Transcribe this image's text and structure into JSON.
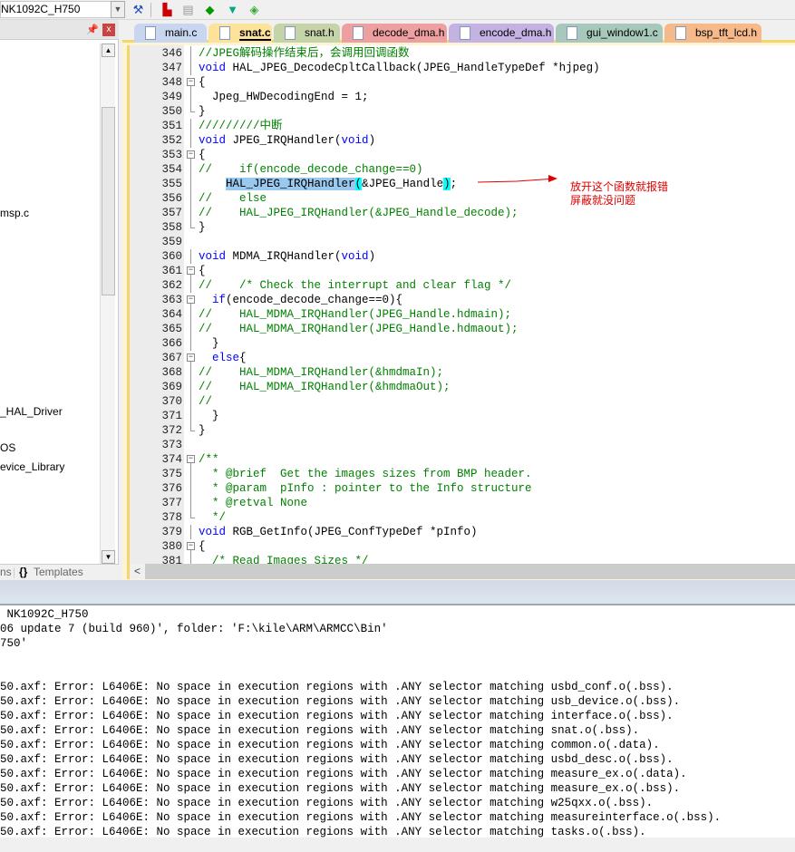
{
  "toolbar": {
    "target": "NK1092C_H750",
    "icons": [
      "magic-wand-icon",
      "build-icon",
      "batch-build-icon",
      "options-icon",
      "filter-icon",
      "pack-installer-icon"
    ]
  },
  "left_panel": {
    "tree_items": [
      "msp.c",
      "_HAL_Driver",
      "OS",
      "evice_Library"
    ],
    "bottom_tabs": [
      "ns",
      "Templates"
    ]
  },
  "tabs": [
    {
      "label": "main.c",
      "color": "#c9d6f0",
      "active": false
    },
    {
      "label": "snat.c",
      "color": "#fde39a",
      "active": true
    },
    {
      "label": "snat.h",
      "color": "#c4d3a8",
      "active": false
    },
    {
      "label": "decode_dma.h",
      "color": "#ee9f9f",
      "active": false
    },
    {
      "label": "encode_dma.h",
      "color": "#c4b2e2",
      "active": false
    },
    {
      "label": "gui_window1.c",
      "color": "#a7c8bb",
      "active": false
    },
    {
      "label": "bsp_tft_lcd.h",
      "color": "#f6b98a",
      "active": false
    }
  ],
  "code": [
    {
      "n": "346",
      "s": [
        [
          "//JPEG解码操作结束后，会调用回调函数",
          "cm"
        ]
      ]
    },
    {
      "n": "347",
      "s": [
        [
          "void",
          "kw"
        ],
        [
          " HAL_JPEG_DecodeCpltCallback(JPEG_HandleTypeDef *hjpeg)",
          "tx"
        ]
      ]
    },
    {
      "n": "348",
      "f": "open",
      "s": [
        [
          "{",
          "tx"
        ]
      ]
    },
    {
      "n": "349",
      "s": [
        [
          "  Jpeg_HWDecodingEnd = 1;",
          "tx"
        ]
      ]
    },
    {
      "n": "350",
      "f": "end",
      "s": [
        [
          "}",
          "tx"
        ]
      ]
    },
    {
      "n": "351",
      "s": [
        [
          "/////////中断",
          "cm"
        ]
      ]
    },
    {
      "n": "352",
      "s": [
        [
          "void",
          "kw"
        ],
        [
          " JPEG_IRQHandler(",
          "tx"
        ],
        [
          "void",
          "kw"
        ],
        [
          ")",
          "tx"
        ]
      ]
    },
    {
      "n": "353",
      "f": "open",
      "s": [
        [
          "{",
          "tx"
        ]
      ]
    },
    {
      "n": "354",
      "s": [
        [
          "//    if(encode_decode_change==0)",
          "cm"
        ]
      ]
    },
    {
      "n": "355",
      "s": [
        [
          "    ",
          "tx"
        ],
        [
          "HAL_JPEG_IRQHandler",
          "hl"
        ],
        [
          "(",
          "br"
        ],
        [
          "&JPEG_Handle",
          "tx"
        ],
        [
          ")",
          "br"
        ],
        [
          ";",
          "tx"
        ]
      ]
    },
    {
      "n": "356",
      "s": [
        [
          "//    else",
          "cm"
        ]
      ]
    },
    {
      "n": "357",
      "s": [
        [
          "//    HAL_JPEG_IRQHandler(&JPEG_Handle_decode);",
          "cm"
        ]
      ]
    },
    {
      "n": "358",
      "f": "end",
      "s": [
        [
          "}",
          "tx"
        ]
      ]
    },
    {
      "n": "359",
      "s": []
    },
    {
      "n": "360",
      "s": [
        [
          "void",
          "kw"
        ],
        [
          " MDMA_IRQHandler(",
          "tx"
        ],
        [
          "void",
          "kw"
        ],
        [
          ")",
          "tx"
        ]
      ]
    },
    {
      "n": "361",
      "f": "open",
      "s": [
        [
          "{",
          "tx"
        ]
      ]
    },
    {
      "n": "362",
      "s": [
        [
          "//    /* Check the interrupt and clear flag */",
          "cm"
        ]
      ]
    },
    {
      "n": "363",
      "f": "open",
      "s": [
        [
          "  ",
          "tx"
        ],
        [
          "if",
          "kw"
        ],
        [
          "(encode_decode_change==0){",
          "tx"
        ]
      ]
    },
    {
      "n": "364",
      "s": [
        [
          "//    HAL_MDMA_IRQHandler(JPEG_Handle.hdmain);",
          "cm"
        ]
      ]
    },
    {
      "n": "365",
      "s": [
        [
          "//    HAL_MDMA_IRQHandler(JPEG_Handle.hdmaout);",
          "cm"
        ]
      ]
    },
    {
      "n": "366",
      "s": [
        [
          "  }",
          "tx"
        ]
      ]
    },
    {
      "n": "367",
      "f": "open",
      "s": [
        [
          "  ",
          "tx"
        ],
        [
          "else",
          "kw"
        ],
        [
          "{",
          "tx"
        ]
      ]
    },
    {
      "n": "368",
      "s": [
        [
          "//    HAL_MDMA_IRQHandler(&hmdmaIn);",
          "cm"
        ]
      ]
    },
    {
      "n": "369",
      "s": [
        [
          "//    HAL_MDMA_IRQHandler(&hmdmaOut);",
          "cm"
        ]
      ]
    },
    {
      "n": "370",
      "s": [
        [
          "//",
          "cm"
        ]
      ]
    },
    {
      "n": "371",
      "s": [
        [
          "  }",
          "tx"
        ]
      ]
    },
    {
      "n": "372",
      "f": "end",
      "s": [
        [
          "}",
          "tx"
        ]
      ]
    },
    {
      "n": "373",
      "s": []
    },
    {
      "n": "374",
      "f": "open",
      "s": [
        [
          "/**",
          "cm"
        ]
      ]
    },
    {
      "n": "375",
      "s": [
        [
          "  * @brief  Get the images sizes from BMP header.",
          "cm"
        ]
      ]
    },
    {
      "n": "376",
      "s": [
        [
          "  * @param  pInfo : pointer to the Info structure",
          "cm"
        ]
      ]
    },
    {
      "n": "377",
      "s": [
        [
          "  * @retval None",
          "cm"
        ]
      ]
    },
    {
      "n": "378",
      "f": "end",
      "s": [
        [
          "  */",
          "cm"
        ]
      ]
    },
    {
      "n": "379",
      "s": [
        [
          "void",
          "kw"
        ],
        [
          " RGB_GetInfo(JPEG_ConfTypeDef *pInfo)",
          "tx"
        ]
      ]
    },
    {
      "n": "380",
      "f": "open",
      "s": [
        [
          "{",
          "tx"
        ]
      ]
    },
    {
      "n": "381",
      "s": [
        [
          "  /* Read Images Sizes */",
          "cm"
        ]
      ]
    }
  ],
  "annotation": {
    "line1": "放开这个函数就报错",
    "line2": "屏蔽就没问题",
    "color": "#e00000"
  },
  "output": [
    " NK1092C_H750",
    "06 update 7 (build 960)', folder: 'F:\\kile\\ARM\\ARMCC\\Bin'",
    "750'",
    "",
    "",
    "50.axf: Error: L6406E: No space in execution regions with .ANY selector matching usbd_conf.o(.bss).",
    "50.axf: Error: L6406E: No space in execution regions with .ANY selector matching usb_device.o(.bss).",
    "50.axf: Error: L6406E: No space in execution regions with .ANY selector matching interface.o(.bss).",
    "50.axf: Error: L6406E: No space in execution regions with .ANY selector matching snat.o(.bss).",
    "50.axf: Error: L6406E: No space in execution regions with .ANY selector matching common.o(.data).",
    "50.axf: Error: L6406E: No space in execution regions with .ANY selector matching usbd_desc.o(.bss).",
    "50.axf: Error: L6406E: No space in execution regions with .ANY selector matching measure_ex.o(.data).",
    "50.axf: Error: L6406E: No space in execution regions with .ANY selector matching measure_ex.o(.bss).",
    "50.axf: Error: L6406E: No space in execution regions with .ANY selector matching w25qxx.o(.bss).",
    "50.axf: Error: L6406E: No space in execution regions with .ANY selector matching measureinterface.o(.bss).",
    "50.axf: Error: L6406E: No space in execution regions with .ANY selector matching tasks.o(.bss)."
  ]
}
